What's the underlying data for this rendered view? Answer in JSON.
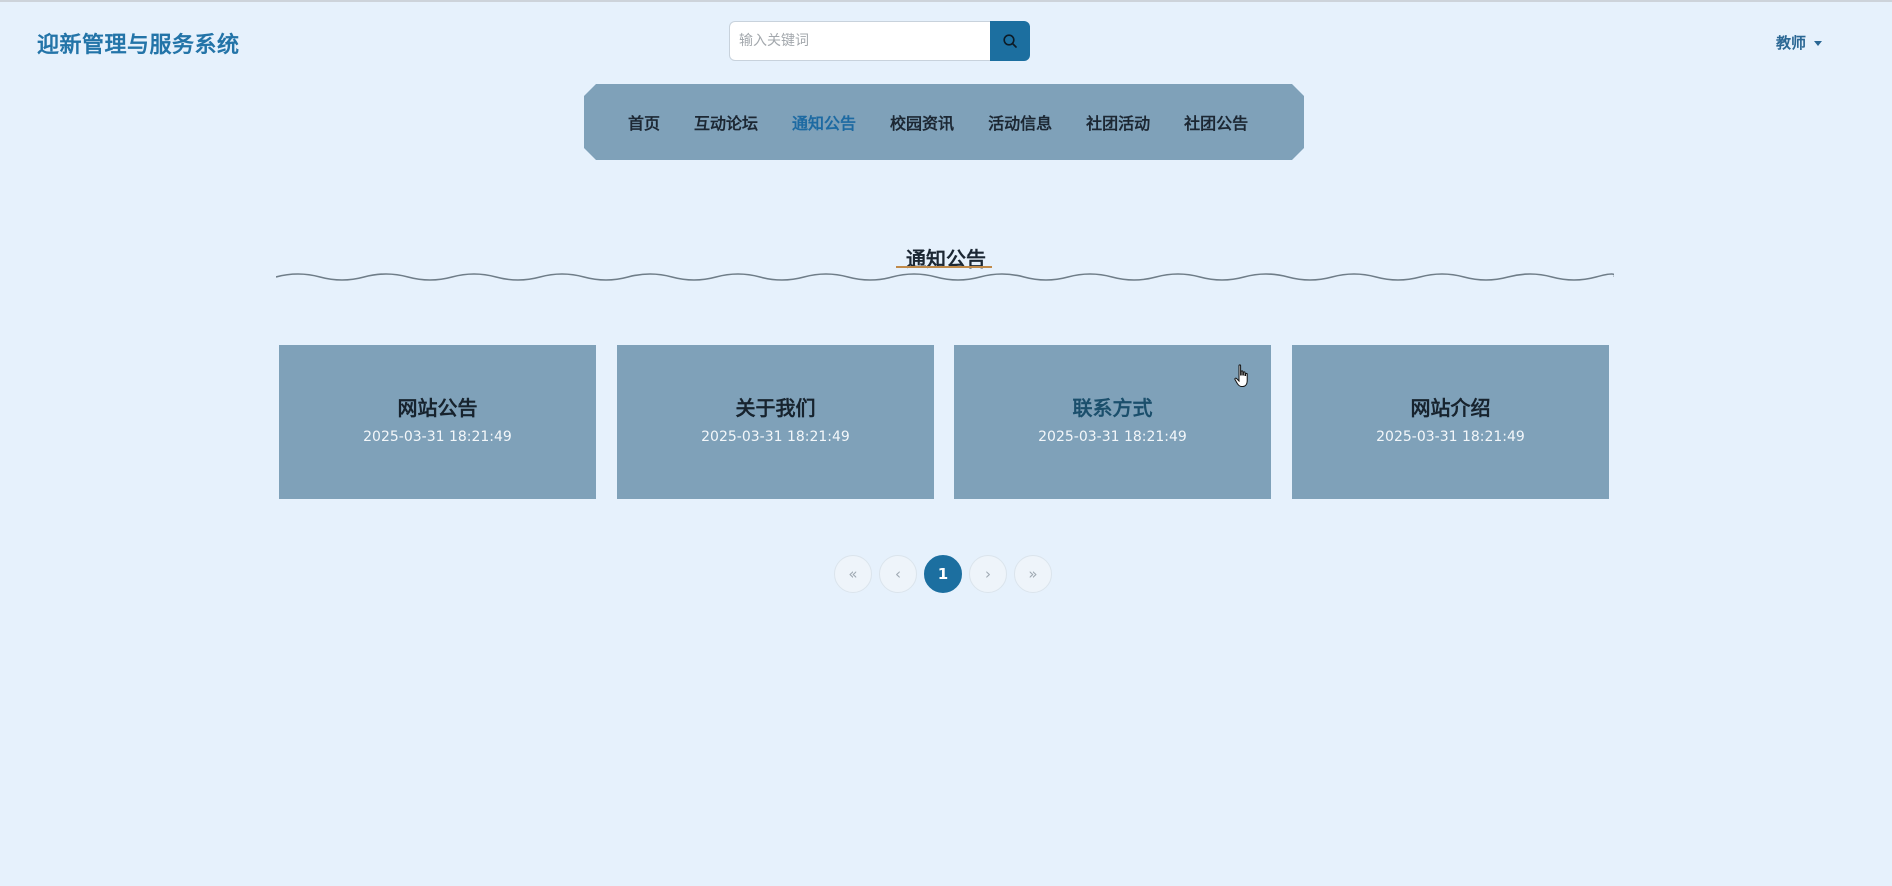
{
  "header": {
    "app_title": "迎新管理与服务系统",
    "search_placeholder": "输入关键词",
    "search_value": "",
    "user_role": "教师"
  },
  "nav": {
    "items": [
      {
        "label": "首页"
      },
      {
        "label": "互动论坛"
      },
      {
        "label": "通知公告",
        "active": true
      },
      {
        "label": "校园资讯"
      },
      {
        "label": "活动信息"
      },
      {
        "label": "社团活动"
      },
      {
        "label": "社团公告"
      }
    ]
  },
  "section": {
    "title": "通知公告"
  },
  "cards": [
    {
      "title": "网站公告",
      "date": "2025-03-31 18:21:49"
    },
    {
      "title": "关于我们",
      "date": "2025-03-31 18:21:49"
    },
    {
      "title": "联系方式",
      "date": "2025-03-31 18:21:49"
    },
    {
      "title": "网站介绍",
      "date": "2025-03-31 18:21:49"
    }
  ],
  "pagination": {
    "first": "«",
    "prev": "‹",
    "current": "1",
    "next": "›",
    "last": "»"
  },
  "colors": {
    "accent": "#1c6fa0",
    "nav_bg": "#7fa1b9",
    "page_bg": "#e6f1fc",
    "brand_text": "#2374a8"
  }
}
